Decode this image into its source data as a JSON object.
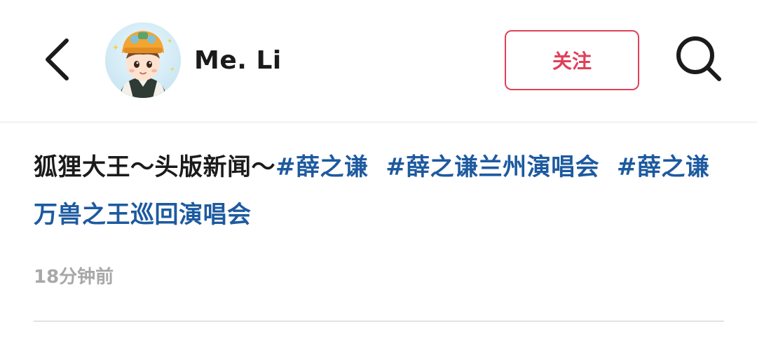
{
  "header": {
    "username": "Me. Li",
    "follow_label": "关注"
  },
  "post": {
    "text": "狐狸大王～头版新闻～",
    "hashtags": [
      "#薛之谦",
      "#薛之谦兰州演唱会",
      "#薛之谦万兽之王巡回演唱会"
    ],
    "time": "18分钟前"
  },
  "colors": {
    "follow_accent": "#e0405a",
    "hashtag": "#1d5aa0",
    "muted_text": "#a8a8a8"
  },
  "icons": {
    "back": "chevron-left-icon",
    "search": "search-icon"
  }
}
